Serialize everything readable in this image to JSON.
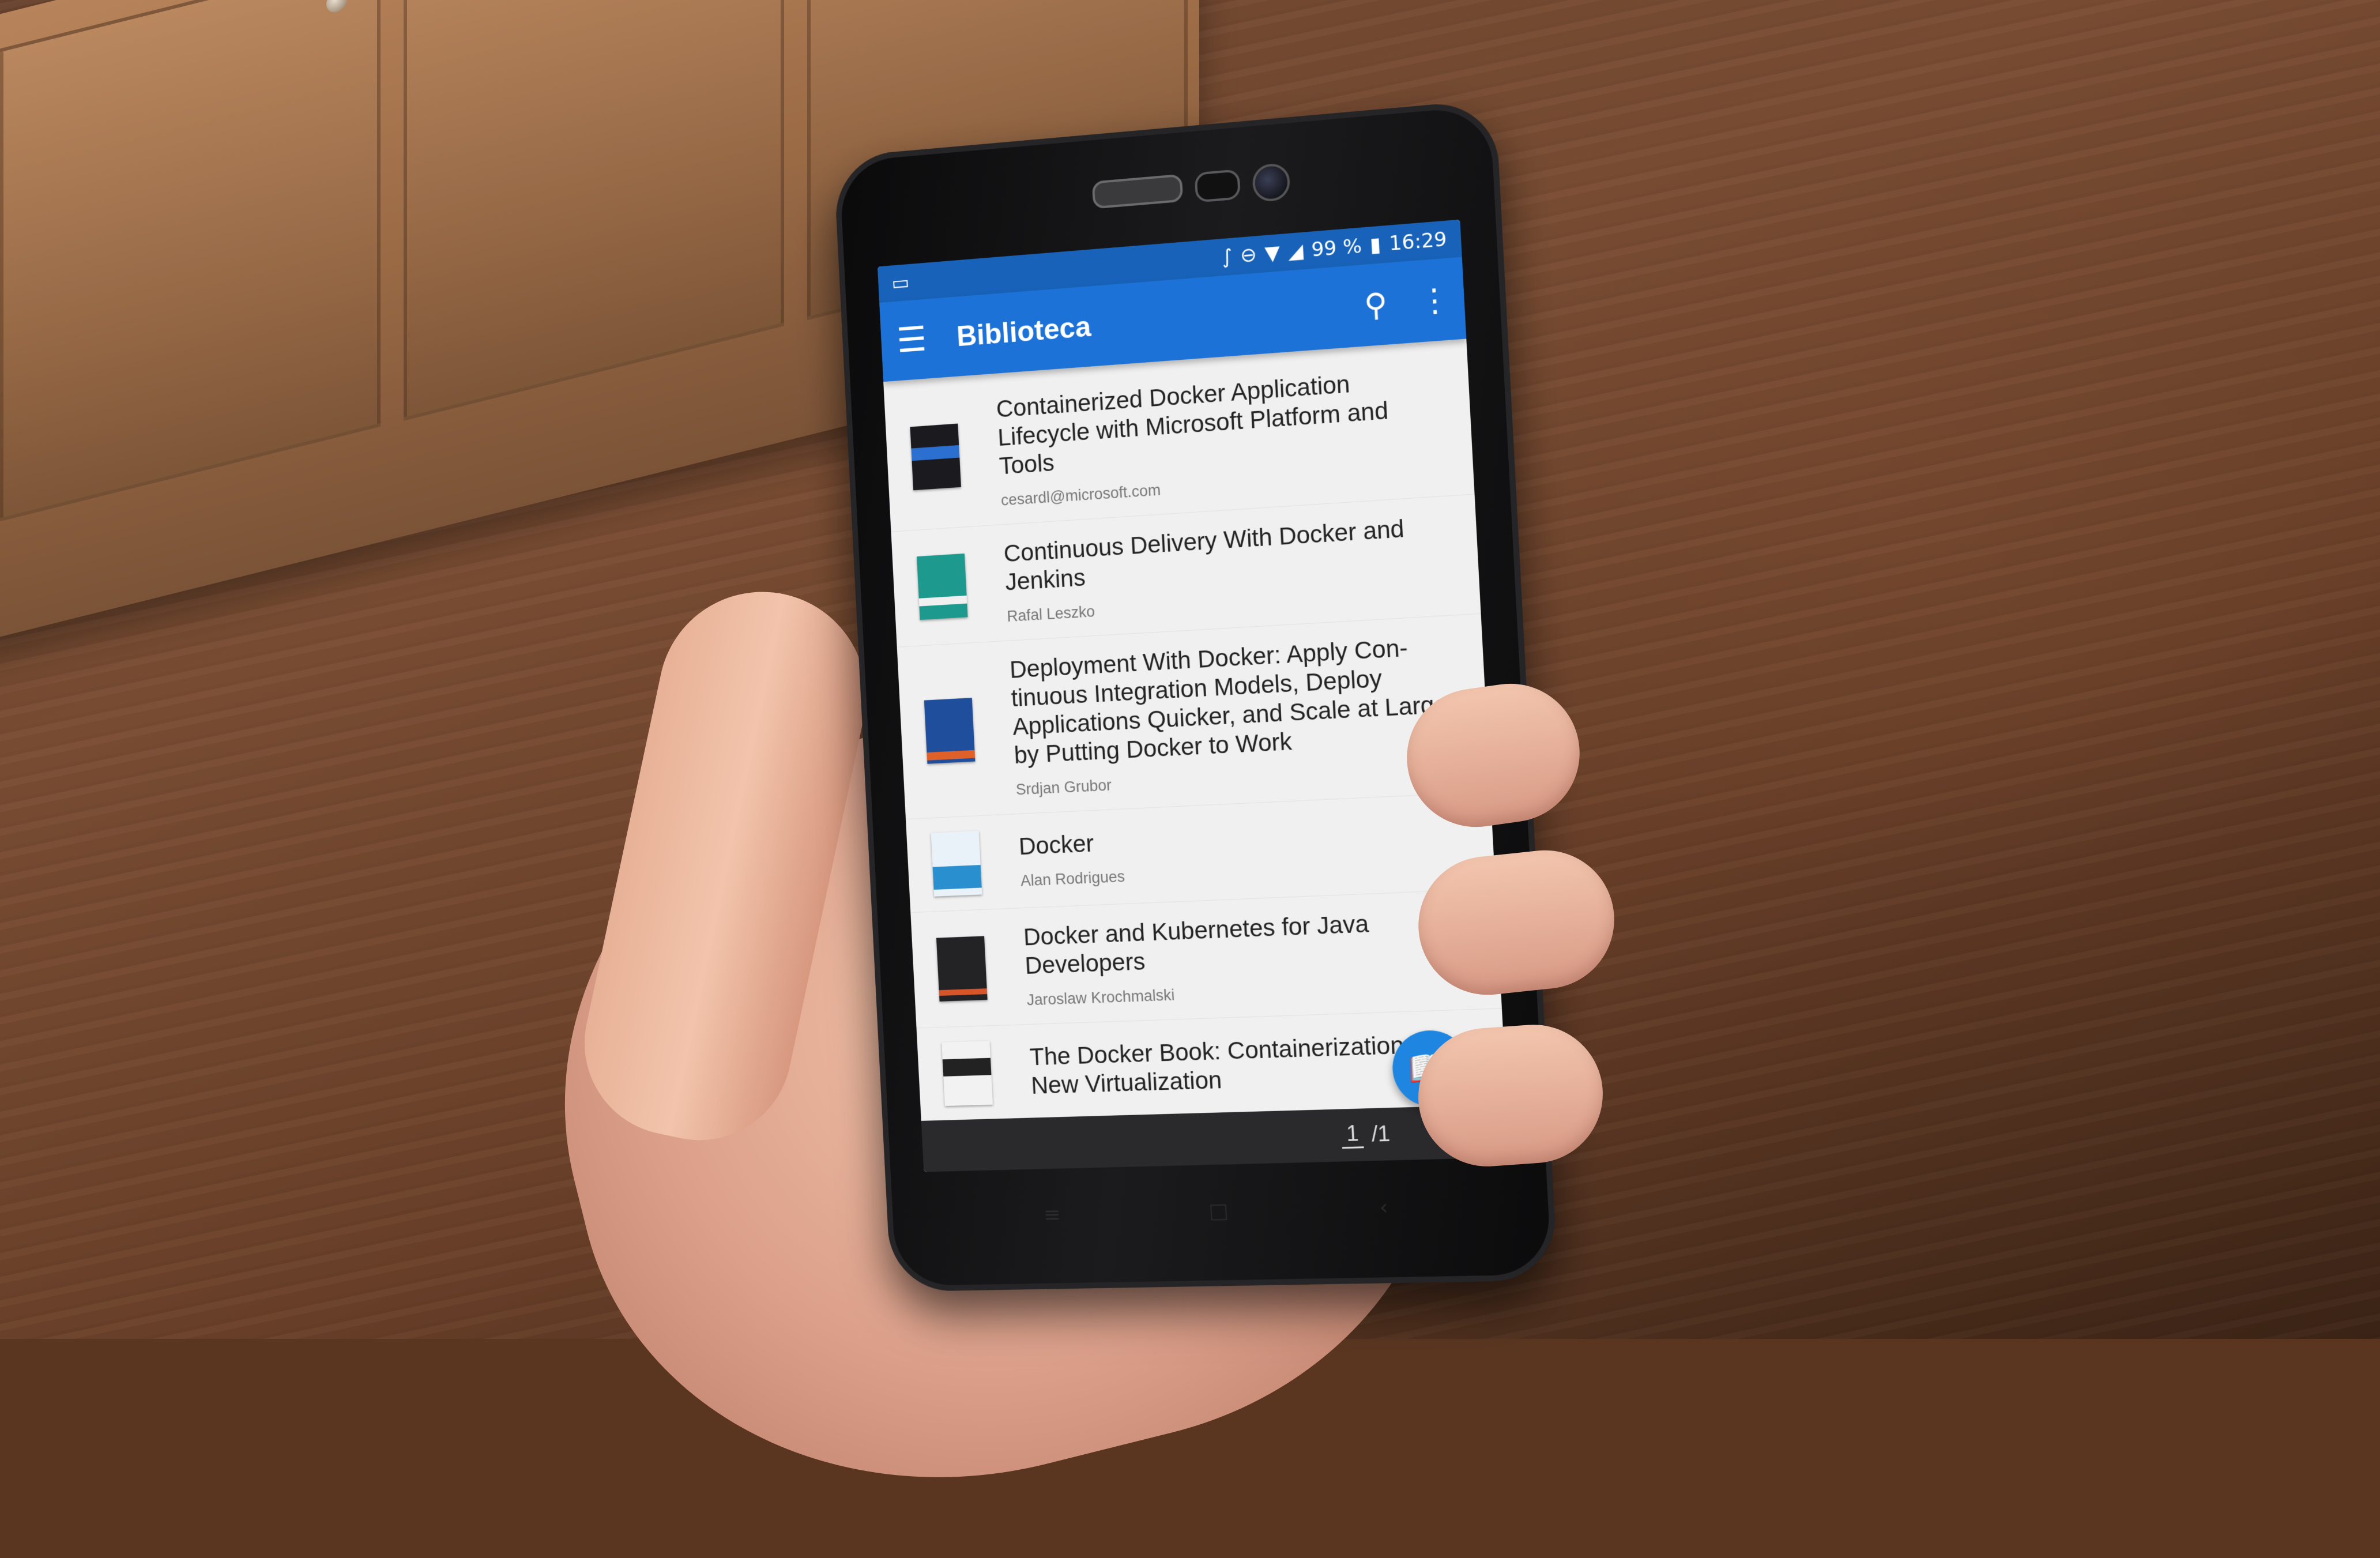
{
  "statusbar": {
    "left_icon": "laptop-icon",
    "battery_percent": "99 %",
    "time": "16:29",
    "icons": [
      "bluetooth-icon",
      "do-not-disturb-icon",
      "wifi-icon",
      "signal-icon",
      "battery-icon"
    ]
  },
  "appbar": {
    "title": "Biblioteca",
    "menu_icon": "hamburger-menu-icon",
    "search_icon": "search-icon",
    "overflow_icon": "more-vertical-icon"
  },
  "books": [
    {
      "title": "Containerized Docker Application Lifecycle with Microsoft Platform and Tools",
      "author": "cesardl@microsoft.com",
      "cover_color": "#1b1b1f",
      "cover_accent": "#2b6fd1"
    },
    {
      "title": "Continuous Delivery With Docker and Jenkins",
      "author": "Rafal Leszko",
      "cover_color": "#1d9a8d",
      "cover_accent": "#f0f0f0"
    },
    {
      "title": "Deployment With Docker: Apply Con-tinuous Integration Models, Deploy Applications Quicker, and Scale at Large by Putting Docker to Work",
      "author": "Srdjan Grubor",
      "cover_color": "#1f4f9c",
      "cover_accent": "#e0602a"
    },
    {
      "title": "Docker",
      "author": "Alan Rodrigues",
      "cover_color": "#e9f2f8",
      "cover_accent": "#2a8fcf"
    },
    {
      "title": "Docker and Kubernetes for Java Developers",
      "author": "Jaroslaw Krochmalski",
      "cover_color": "#232326",
      "cover_accent": "#d8552a"
    },
    {
      "title": "The Docker Book: Containerization Is the New Virtualization",
      "author": "",
      "cover_color": "#f2f2f2",
      "cover_accent": "#222222"
    }
  ],
  "fab": {
    "icon": "open-book-icon"
  },
  "pager": {
    "current": "1",
    "total": "/1"
  }
}
